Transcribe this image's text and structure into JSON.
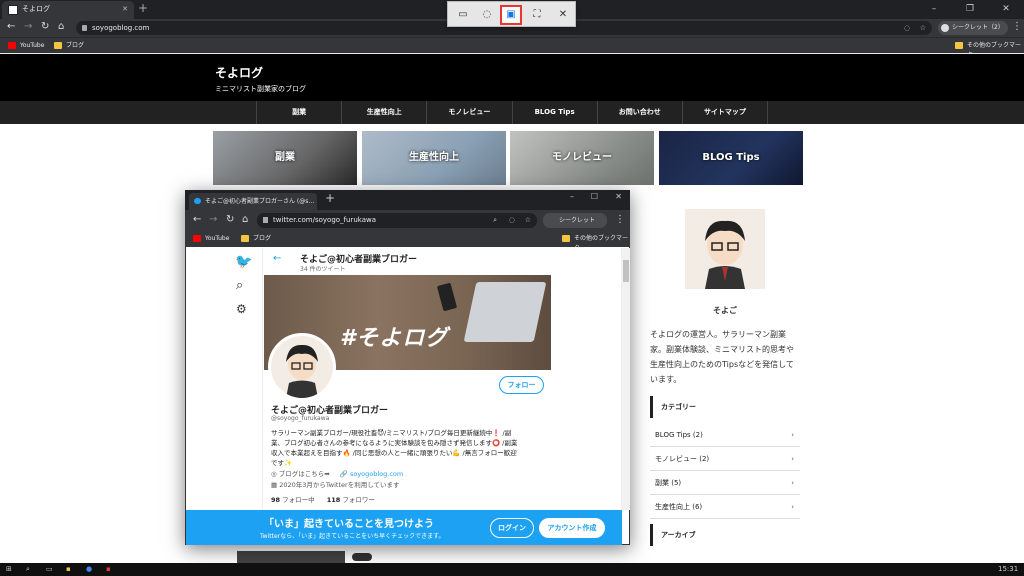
{
  "browser": {
    "tab_title": "そよログ",
    "url": "soyogoblog.com",
    "incognito_label": "シークレット（2）",
    "bookmarks": [
      "YouTube",
      "ブログ"
    ],
    "other_bookmarks": "その他のブックマーク"
  },
  "snip": {
    "icons": [
      "rect-snip-icon",
      "freeform-snip-icon",
      "window-snip-icon",
      "fullscreen-snip-icon",
      "close-icon"
    ]
  },
  "site": {
    "title": "そよログ",
    "subtitle": "ミニマリスト副業家のブログ",
    "nav": [
      "副業",
      "生産性向上",
      "モノレビュー",
      "BLOG Tips",
      "お問い合わせ",
      "サイトマップ"
    ],
    "cards": [
      "副業",
      "生産性向上",
      "モノレビュー",
      "BLOG Tips"
    ]
  },
  "sidebar": {
    "author": "そよご",
    "bio": [
      "そよログの運営人。サラリーマン副業",
      "家。副業体験談、ミニマリスト的思考や",
      "生産性向上のためのTipsなどを発信して",
      "います。"
    ],
    "category_heading": "カテゴリー",
    "categories": [
      "BLOG Tips (2)",
      "モノレビュー (2)",
      "副業 (5)",
      "生産性向上 (6)"
    ],
    "archive_heading": "アーカイブ"
  },
  "popup": {
    "tab_title": "そよご@初心者副業ブロガーさん (@s…",
    "url": "twitter.com/soyogo_furukawa",
    "incognito_label": "シークレット（2）",
    "bookmarks": [
      "YouTube",
      "ブログ"
    ],
    "other_bookmarks": "その他のブックマーク",
    "profile_name_header": "そよご@初心者副業ブロガー",
    "tweet_count": "34 件のツイート",
    "banner_text": "#そよログ",
    "follow_label": "フォロー",
    "display_name": "そよご@初心者副業ブロガー",
    "handle": "@soyogo_furukawa",
    "bio_lines": [
      "サラリーマン副業ブロガー/現役社畜😈/ミニマリスト/ブログ毎日更新継続中❗ /副",
      "業、ブログ初心者さんの参考になるように実体験談を包み隠さず発信します⭕ /副業",
      "収入で本業超えを目指す🔥 /同じ思想の人と一緒に頑張りたい💪 /無言フォロー歓迎",
      "です✨"
    ],
    "link_text": "ブログはこちら➡",
    "website": "soyogoblog.com",
    "joined": "2020年3月からTwitterを利用しています",
    "following_count": "98",
    "following_label": "フォロー中",
    "followers_count": "118",
    "followers_label": "フォロワー",
    "bottom_title": "「いま」起きていることを見つけよう",
    "bottom_sub": "Twitterなら、「いま」起きていることをいち早くチェックできます。",
    "login_label": "ログイン",
    "signup_label": "アカウント作成"
  },
  "taskbar": {
    "time": "15:31"
  }
}
